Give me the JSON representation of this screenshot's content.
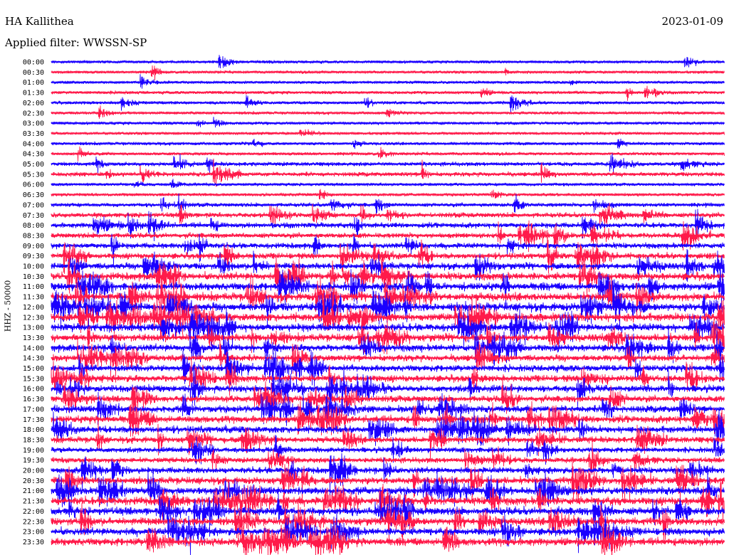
{
  "header": {
    "station": "HA Kallithea",
    "date": "2023-01-09",
    "filter": "Applied filter: WWSSN-SP"
  },
  "colors": {
    "row_even": "#1a00ff",
    "row_odd": "#ff1a4a",
    "background": "#ffffff"
  },
  "chart_data": {
    "type": "line",
    "title": "HA Kallithea",
    "subtitle": "Applied filter: WWSSN-SP",
    "ylabel": "HHZ - 50000",
    "grid": false,
    "row_labels": [
      "00:00",
      "00:30",
      "01:00",
      "01:30",
      "02:00",
      "02:30",
      "03:00",
      "03:30",
      "04:00",
      "04:30",
      "05:00",
      "05:30",
      "06:00",
      "06:30",
      "07:00",
      "07:30",
      "08:00",
      "08:30",
      "09:00",
      "09:30",
      "10:00",
      "10:30",
      "11:00",
      "11:30",
      "12:00",
      "12:30",
      "13:00",
      "13:30",
      "14:00",
      "14:30",
      "15:00",
      "15:30",
      "16:00",
      "16:30",
      "17:00",
      "17:30",
      "18:00",
      "18:30",
      "19:00",
      "19:30",
      "20:00",
      "20:30",
      "21:00",
      "21:30",
      "22:00",
      "22:30",
      "23:00",
      "23:30"
    ],
    "row_activity": [
      0.1,
      0.1,
      0.1,
      0.15,
      0.15,
      0.12,
      0.12,
      0.1,
      0.15,
      0.15,
      0.3,
      0.35,
      0.15,
      0.15,
      0.3,
      0.45,
      0.5,
      0.5,
      0.55,
      0.6,
      0.7,
      0.85,
      0.9,
      0.95,
      1.0,
      0.95,
      0.9,
      0.85,
      0.8,
      0.7,
      0.7,
      0.75,
      0.75,
      0.7,
      0.75,
      0.8,
      0.75,
      0.65,
      0.5,
      0.5,
      0.65,
      0.8,
      0.9,
      0.95,
      0.95,
      0.9,
      0.85,
      0.9
    ],
    "events": [
      {
        "row": 0,
        "time_min": 7.5,
        "amplitude": 3.0
      },
      {
        "row": 1,
        "time_min": 4.5,
        "amplitude": 2.0
      },
      {
        "row": 2,
        "time_min": 4.0,
        "amplitude": 2.5
      },
      {
        "row": 3,
        "time_min": 26.5,
        "amplitude": 3.0
      },
      {
        "row": 4,
        "time_min": 20.5,
        "amplitude": 3.5
      },
      {
        "row": 4,
        "time_min": 14.0,
        "amplitude": 1.5
      },
      {
        "row": 5,
        "time_min": 15.0,
        "amplitude": 1.5
      },
      {
        "row": 6,
        "time_min": 6.5,
        "amplitude": 1.5
      },
      {
        "row": 8,
        "time_min": 13.5,
        "amplitude": 1.5
      },
      {
        "row": 10,
        "time_min": 5.5,
        "amplitude": 3.5
      },
      {
        "row": 11,
        "time_min": 4.0,
        "amplitude": 3.0
      },
      {
        "row": 14,
        "time_min": 12.5,
        "amplitude": 3.0
      },
      {
        "row": 14,
        "time_min": 14.5,
        "amplitude": 2.5
      },
      {
        "row": 15,
        "time_min": 15.0,
        "amplitude": 2.5
      }
    ]
  }
}
